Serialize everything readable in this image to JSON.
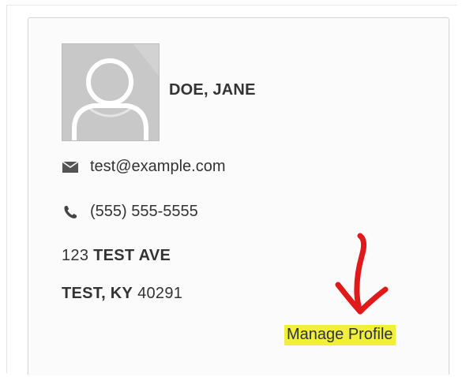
{
  "profile_card": {
    "name": "DOE, JANE",
    "email": "test@example.com",
    "phone": "(555) 555-5555",
    "address_line1_number": "123",
    "address_line1_street": "TEST AVE",
    "address_line2_city": "TEST, KY",
    "address_line2_zip": "40291",
    "manage_label": "Manage Profile"
  },
  "icons": {
    "avatar": "user-silhouette-icon",
    "email": "envelope-icon",
    "phone": "phone-icon",
    "annotation": "red-arrow-down-icon"
  },
  "colors": {
    "highlight": "#f2ef3a",
    "annotation_red": "#e0191b",
    "text": "#333333"
  }
}
